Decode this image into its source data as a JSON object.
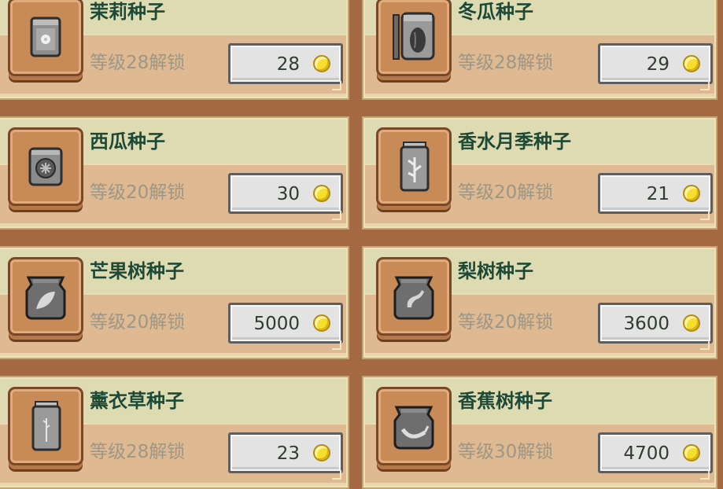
{
  "shop": {
    "items": [
      {
        "name": "茉莉种子",
        "unlock_text": "等级28解锁",
        "price": "28",
        "icon": "jasmine-seed-icon"
      },
      {
        "name": "冬瓜种子",
        "unlock_text": "等级28解锁",
        "price": "29",
        "icon": "winter-melon-seed-icon"
      },
      {
        "name": "西瓜种子",
        "unlock_text": "等级20解锁",
        "price": "30",
        "icon": "watermelon-seed-icon"
      },
      {
        "name": "香水月季种子",
        "unlock_text": "等级20解锁",
        "price": "21",
        "icon": "rose-seed-icon"
      },
      {
        "name": "芒果树种子",
        "unlock_text": "等级20解锁",
        "price": "5000",
        "icon": "mango-tree-seed-icon"
      },
      {
        "name": "梨树种子",
        "unlock_text": "等级20解锁",
        "price": "3600",
        "icon": "pear-tree-seed-icon"
      },
      {
        "name": "薰衣草种子",
        "unlock_text": "等级28解锁",
        "price": "23",
        "icon": "lavender-seed-icon"
      },
      {
        "name": "香蕉树种子",
        "unlock_text": "等级30解锁",
        "price": "4700",
        "icon": "banana-tree-seed-icon"
      }
    ],
    "currency_icon": "gold-coin-icon"
  },
  "colors": {
    "background": "#a56a44",
    "card_top": "#dedbb3",
    "card_body": "#dfb991",
    "name_text": "#1c4a36",
    "unlock_text": "#9c9786",
    "coin": "#f6de2c"
  }
}
